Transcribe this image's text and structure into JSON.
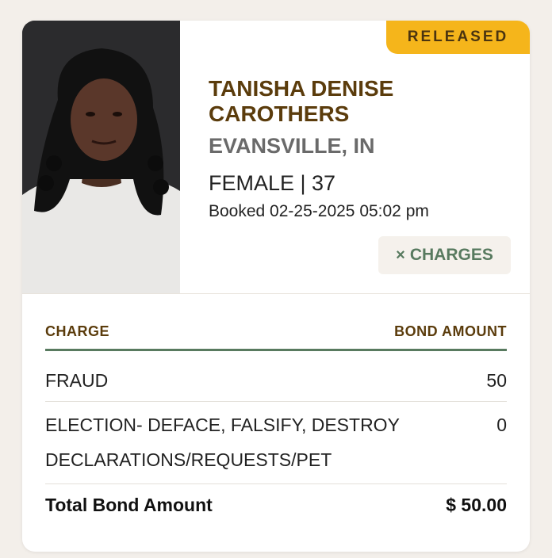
{
  "status_badge": "RELEASED",
  "person": {
    "name": "TANISHA DENISE CAROTHERS",
    "location": "EVANSVILLE, IN",
    "demographics": "FEMALE | 37",
    "booked": "Booked 02-25-2025 05:02 pm"
  },
  "charges_button": {
    "icon": "×",
    "label": "CHARGES"
  },
  "table": {
    "headers": {
      "charge": "CHARGE",
      "bond": "BOND AMOUNT"
    },
    "rows": [
      {
        "charge": "FRAUD",
        "bond": "50"
      },
      {
        "charge": "ELECTION- DEFACE, FALSIFY, DESTROY DECLARATIONS/REQUESTS/PET",
        "bond": "0"
      }
    ],
    "total": {
      "label": "Total Bond Amount",
      "value": "$ 50.00"
    }
  },
  "colors": {
    "brown": "#5b3c0c",
    "gold": "#f5b51b",
    "green": "#587a5f",
    "background": "#f3efea"
  }
}
